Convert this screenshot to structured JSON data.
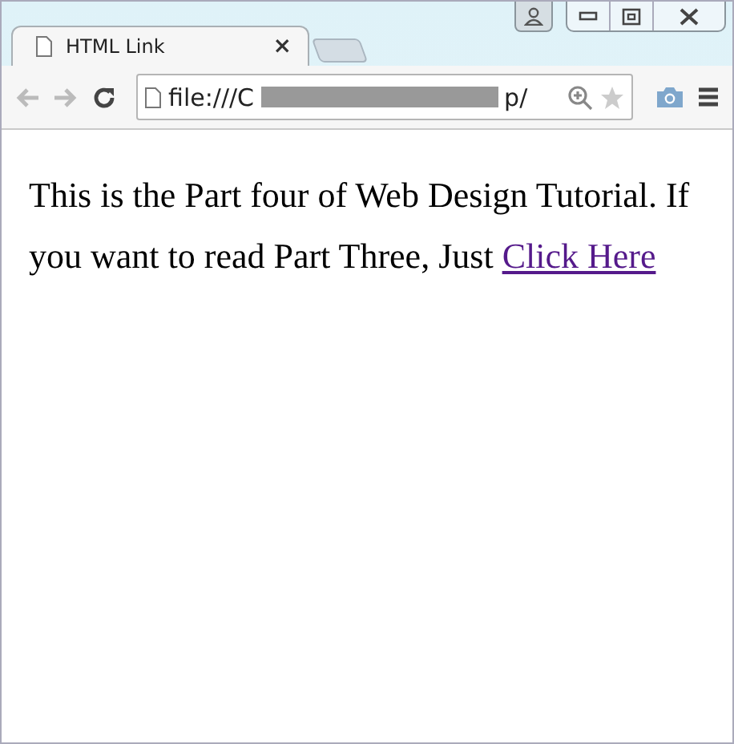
{
  "tab": {
    "title": "HTML Link",
    "close": "×"
  },
  "toolbar": {
    "address_start": "file:///C",
    "address_end": "p/"
  },
  "page": {
    "text": "This is the Part four of Web Design Tutorial. If you want to read Part Three, Just ",
    "link": "Click Here"
  }
}
